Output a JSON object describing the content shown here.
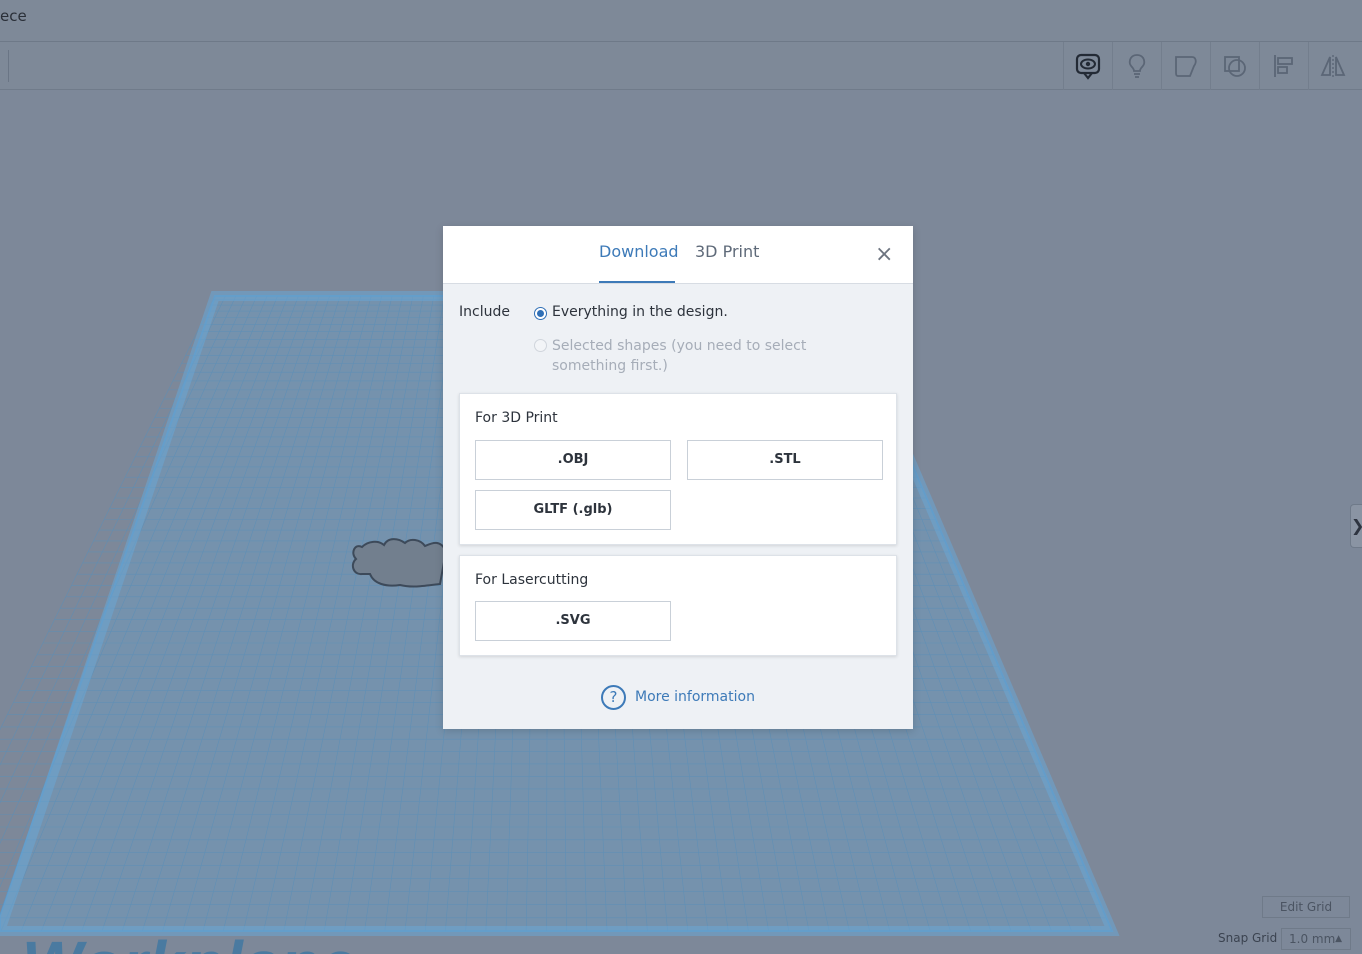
{
  "app": {
    "title_fragment": "ece"
  },
  "toolbar": {
    "tools": [
      {
        "name": "show-all-icon"
      },
      {
        "name": "lightbulb-icon"
      },
      {
        "name": "group-shapes-icon"
      },
      {
        "name": "ungroup-shapes-icon"
      },
      {
        "name": "align-icon"
      },
      {
        "name": "mirror-icon"
      }
    ]
  },
  "workspace": {
    "workplane_label": "Workplane",
    "edit_grid_label": "Edit Grid",
    "snap_grid_label": "Snap Grid",
    "snap_grid_value": "1.0 mm",
    "side_handle_glyph": "❯"
  },
  "dialog": {
    "tabs": {
      "download": "Download",
      "print": "3D Print"
    },
    "close_glyph": "×",
    "include_label": "Include",
    "option_everything": "Everything in the design.",
    "option_selected": "Selected shapes (you need to select something first.)",
    "section_3d_title": "For 3D Print",
    "btn_obj": ".OBJ",
    "btn_stl": ".STL",
    "btn_gltf": "GLTF (.glb)",
    "section_laser_title": "For Lasercutting",
    "btn_svg": ".SVG",
    "help_glyph": "?",
    "more_info": "More information"
  },
  "colors": {
    "accent": "#3d7ab8",
    "overlay_background": "#7d8899",
    "grid_line": "#5a8fb8"
  }
}
